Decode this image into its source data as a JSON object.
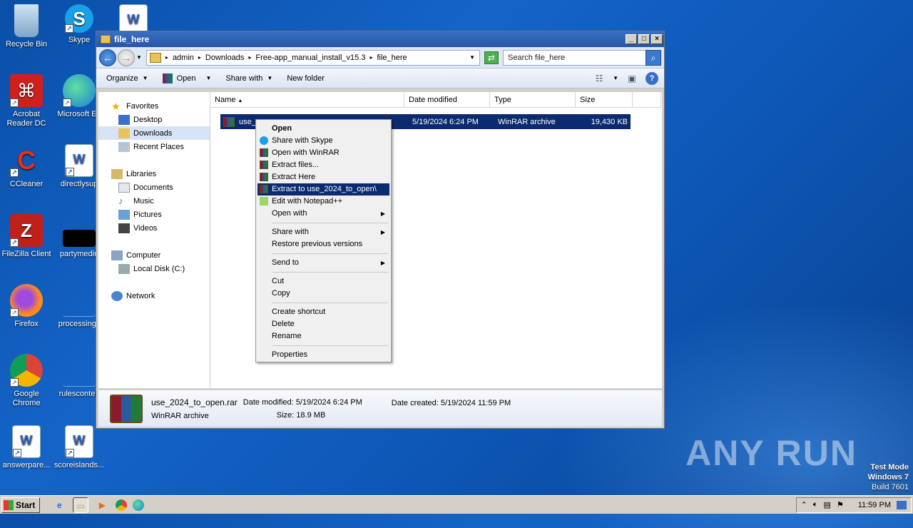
{
  "desktop": {
    "icons": [
      {
        "label": "Recycle Bin"
      },
      {
        "label": "Skype"
      },
      {
        "label": "Acrobat Reader DC"
      },
      {
        "label": "Microsoft Ed"
      },
      {
        "label": "CCleaner"
      },
      {
        "label": "directlysup"
      },
      {
        "label": "FileZilla Client"
      },
      {
        "label": "partymediu"
      },
      {
        "label": "Firefox"
      },
      {
        "label": "processingc"
      },
      {
        "label": "Google Chrome"
      },
      {
        "label": "rulesconten"
      },
      {
        "label": "answerpare..."
      },
      {
        "label": "scoreislands..."
      }
    ],
    "watermark": "ANY RUN",
    "test_mode": {
      "line1": "Test Mode",
      "line2": "Windows 7",
      "line3": "Build 7601"
    }
  },
  "window": {
    "title": "file_here",
    "breadcrumb": [
      "admin",
      "Downloads",
      "Free-app_manual_install_v15.3",
      "file_here"
    ],
    "search_placeholder": "Search file_here",
    "toolbar": {
      "organize": "Organize",
      "open": "Open",
      "share_with": "Share with",
      "new_folder": "New folder"
    },
    "nav": {
      "favorites": "Favorites",
      "desktop": "Desktop",
      "downloads": "Downloads",
      "recent_places": "Recent Places",
      "libraries": "Libraries",
      "documents": "Documents",
      "music": "Music",
      "pictures": "Pictures",
      "videos": "Videos",
      "computer": "Computer",
      "local_disk": "Local Disk (C:)",
      "network": "Network"
    },
    "columns": {
      "name": "Name",
      "date_modified": "Date modified",
      "type": "Type",
      "size": "Size"
    },
    "file": {
      "name": "use_",
      "date": "5/19/2024 6:24 PM",
      "type": "WinRAR archive",
      "size": "19,430 KB"
    },
    "details": {
      "filename": "use_2024_to_open.rar",
      "type": "WinRAR archive",
      "date_modified_label": "Date modified:",
      "date_modified": "5/19/2024 6:24 PM",
      "size_label": "Size:",
      "size": "18.9 MB",
      "date_created_label": "Date created:",
      "date_created": "5/19/2024 11:59 PM"
    }
  },
  "context_menu": {
    "open": "Open",
    "share_skype": "Share with Skype",
    "open_winrar": "Open with WinRAR",
    "extract_files": "Extract files...",
    "extract_here": "Extract Here",
    "extract_to": "Extract to use_2024_to_open\\",
    "edit_notepad": "Edit with Notepad++",
    "open_with": "Open with",
    "share_with": "Share with",
    "restore": "Restore previous versions",
    "send_to": "Send to",
    "cut": "Cut",
    "copy": "Copy",
    "create_shortcut": "Create shortcut",
    "delete": "Delete",
    "rename": "Rename",
    "properties": "Properties"
  },
  "taskbar": {
    "start": "Start",
    "clock": "11:59 PM"
  }
}
